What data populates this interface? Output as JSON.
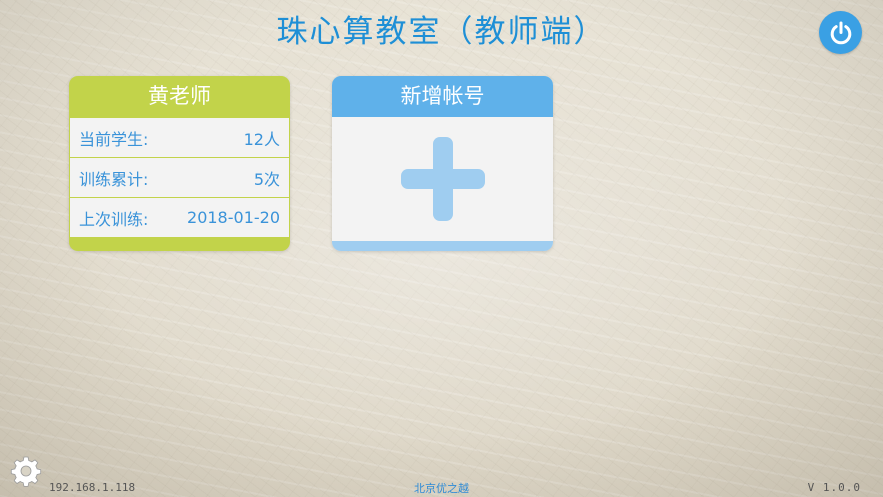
{
  "header": {
    "title": "珠心算教室（教师端）",
    "power_icon": "power-icon"
  },
  "teacher_card": {
    "name": "黄老师",
    "rows": [
      {
        "label": "当前学生:",
        "value": "12人"
      },
      {
        "label": "训练累计:",
        "value": "5次"
      },
      {
        "label": "上次训练:",
        "value": "2018-01-20"
      }
    ],
    "accent_color": "#c2d34a"
  },
  "add_card": {
    "title": "新增帐号",
    "plus_icon": "plus-icon",
    "accent_color": "#5fb1ea"
  },
  "footer": {
    "ip": "192.168.1.118",
    "company": "北京优之越",
    "version": "V 1.0.0",
    "settings_icon": "gear-icon"
  },
  "colors": {
    "title_blue": "#1e8fd6",
    "power_blue": "#3aa0e4",
    "plus_blue": "#9fcdf0"
  }
}
